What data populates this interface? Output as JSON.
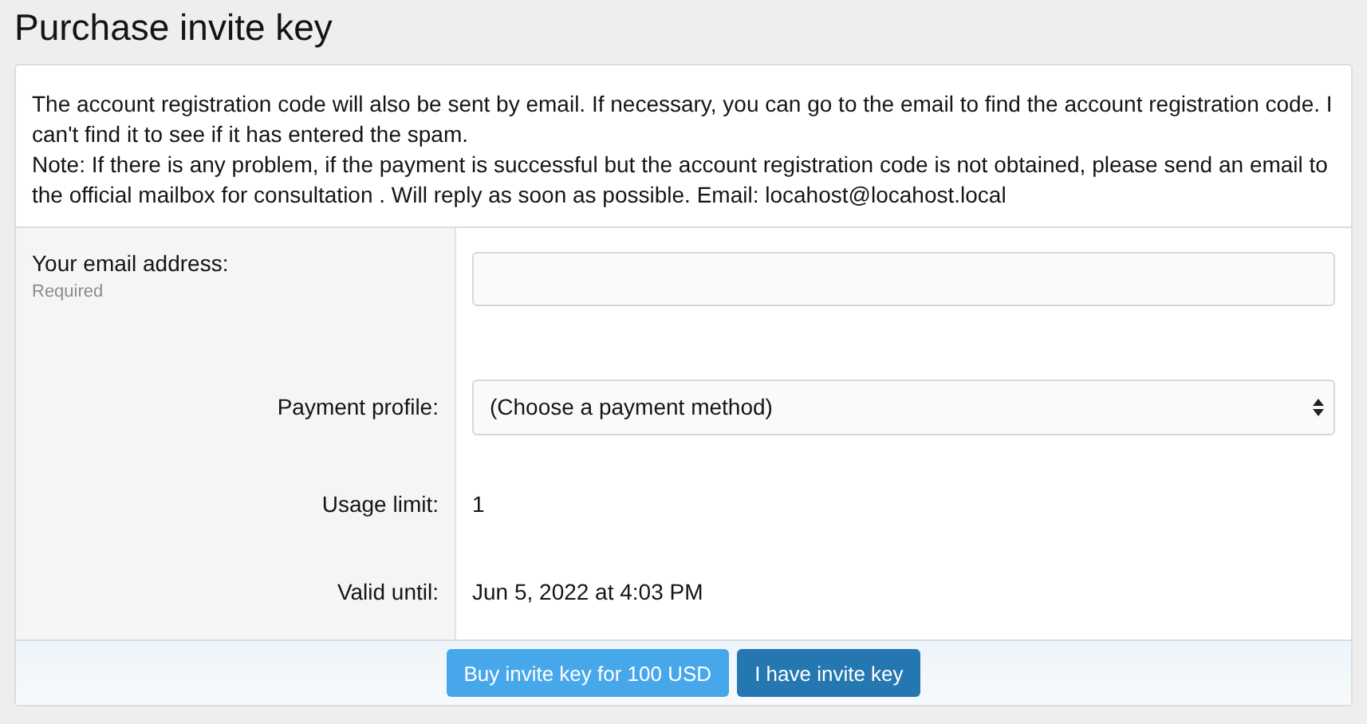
{
  "title": "Purchase invite key",
  "intro": [
    "The account registration code will also be sent by email. If necessary, you can go to the email to find the account registration code. I can't find it to see if it has entered the spam.",
    "Note: If there is any problem, if the payment is successful but the account registration code is not obtained, please send an email to the official mailbox for consultation . Will reply as soon as possible. Email: locahost@locahost.local"
  ],
  "rows": [
    {
      "kind": "input",
      "label": "Your email address:",
      "hint": "Required"
    },
    {
      "kind": "select",
      "label": "Payment profile:",
      "value": "(Choose a payment method)"
    },
    {
      "kind": "text",
      "label": "Usage limit:",
      "value": "1"
    },
    {
      "kind": "text",
      "label": "Valid until:",
      "value": "Jun 5, 2022 at 4:03 PM"
    }
  ],
  "buttons": [
    {
      "label": "Buy invite key for 100 USD",
      "kind": "primary"
    },
    {
      "label": "I have invite key",
      "kind": "secondary"
    }
  ]
}
